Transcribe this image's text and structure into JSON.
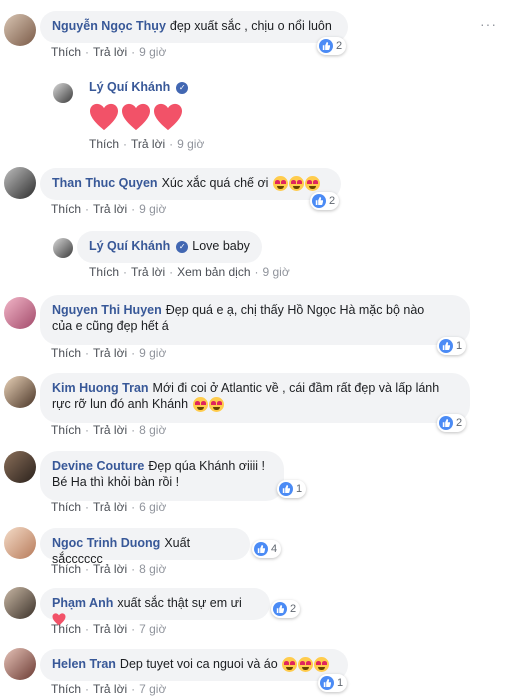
{
  "actions": {
    "like": "Thích",
    "reply": "Trả lời",
    "translate": "Xem bản dịch",
    "sep": "·"
  },
  "comments": [
    {
      "name": "Nguyễn Ngọc Thụy",
      "text": "đẹp xuất sắc , chịu o nổi luôn",
      "time": "9 giờ",
      "likes": "2"
    },
    {
      "name": "Lý Quí Khánh",
      "text": "",
      "time": "9 giờ",
      "hearts": 3,
      "verified": true
    },
    {
      "name": "Than Thuc Quyen",
      "text": "Xúc xắc quá chế ơi",
      "time": "9 giờ",
      "likes": "2"
    },
    {
      "name": "Lý Quí Khánh",
      "text": "Love baby",
      "time": "9 giờ",
      "verified": true
    },
    {
      "name": "Nguyen Thi Huyen",
      "text": "Đẹp quá e ạ, chị thấy Hồ Ngọc Hà mặc bộ nào",
      "text2": "của e cũng đẹp hết á",
      "time": "9 giờ",
      "likes": "1"
    },
    {
      "name": "Kim Huong Tran",
      "text": "Mới đi coi ở Atlantic về , cái đầm rất đẹp và lấp lánh",
      "text2": "rực rỡ lun đó anh Khánh",
      "time": "8 giờ",
      "likes": "2"
    },
    {
      "name": "Devine Couture",
      "text": "Đẹp qúa Khánh ơiiii !",
      "text2": "Bé Ha thì khỏi bàn rồi !",
      "time": "6 giờ",
      "likes": "1"
    },
    {
      "name": "Ngoc Trinh Duong",
      "text": "Xuất sắcccccc",
      "time": "8 giờ",
      "likes": "4"
    },
    {
      "name": "Phạm Anh",
      "text": "xuất sắc thật sự em ưi",
      "time": "7 giờ",
      "likes": "2"
    },
    {
      "name": "Helen Tran",
      "text": "Dep tuyet voi ca nguoi và áo",
      "time": "7 giờ",
      "likes": "1"
    }
  ],
  "colors": {
    "link": "#385898",
    "bubble": "#f2f3f5",
    "like": "#4b8bf5",
    "heart": "#f25268"
  }
}
